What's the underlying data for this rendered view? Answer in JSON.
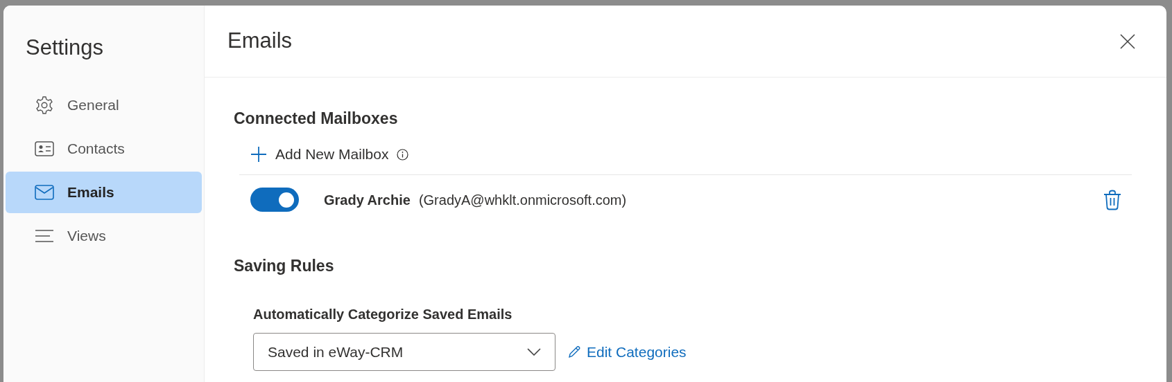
{
  "sidebar": {
    "title": "Settings",
    "items": [
      {
        "label": "General",
        "selected": false
      },
      {
        "label": "Contacts",
        "selected": false
      },
      {
        "label": "Emails",
        "selected": true
      },
      {
        "label": "Views",
        "selected": false
      }
    ]
  },
  "panel": {
    "title": "Emails"
  },
  "connected_mailboxes": {
    "title": "Connected Mailboxes",
    "add_button": "Add New Mailbox",
    "mailboxes": [
      {
        "name": "Grady Archie",
        "address": "(GradyA@whklt.onmicrosoft.com)",
        "on": true
      }
    ]
  },
  "saving_rules": {
    "title": "Saving Rules",
    "label": "Automatically Categorize Saved Emails",
    "value": "Saved in eWay-CRM",
    "link": "Edit Categories"
  }
}
